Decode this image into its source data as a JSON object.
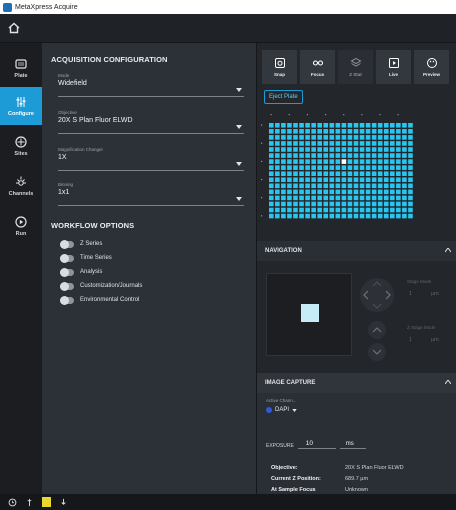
{
  "app": {
    "title": "MetaXpress Acquire"
  },
  "sidebar": {
    "items": [
      {
        "label": "Plate",
        "icon": "plate-icon"
      },
      {
        "label": "Configure",
        "icon": "sliders-icon",
        "active": true
      },
      {
        "label": "Sites",
        "icon": "sites-icon"
      },
      {
        "label": "Channels",
        "icon": "sun-icon"
      },
      {
        "label": "Run",
        "icon": "play-icon"
      }
    ]
  },
  "acquisition": {
    "title": "ACQUISITION CONFIGURATION",
    "fields": [
      {
        "label": "Mode",
        "value": "Widefield"
      },
      {
        "label": "Objective",
        "value": "20X S Plan Fluor ELWD"
      },
      {
        "label": "Magnification Changer",
        "value": "1X"
      },
      {
        "label": "Binning",
        "value": "1x1"
      }
    ]
  },
  "workflow": {
    "title": "WORKFLOW OPTIONS",
    "options": [
      "Z Series",
      "Time Series",
      "Analysis",
      "Customization/Journals",
      "Environmental Control"
    ]
  },
  "toolbar": {
    "buttons": [
      {
        "label": "Snap",
        "icon": "camera-icon"
      },
      {
        "label": "Focus",
        "icon": "focus-icon"
      },
      {
        "label": "Z Stat",
        "icon": "layers-icon"
      },
      {
        "label": "Live",
        "icon": "live-icon"
      },
      {
        "label": "Preview",
        "icon": "palette-icon"
      }
    ],
    "eject_label": "Eject Plate"
  },
  "plate": {
    "rows": 16,
    "cols": 24,
    "well_color": "#29c6f0",
    "selected_well_color": "#ffffff",
    "selected": {
      "row": 6,
      "col": 12
    }
  },
  "navigation": {
    "title": "NAVIGATION",
    "stage_label": "Stage Mode",
    "stage_value": "1",
    "stage_unit": "µm",
    "z_label": "Z Stage Mode",
    "z_value": "1",
    "z_unit": "µm"
  },
  "capture": {
    "title": "IMAGE CAPTURE",
    "active_channel_label": "Active Chann...",
    "active_channel": "DAPI",
    "exposure_label": "EXPOSURE",
    "exposure_value": "10",
    "exposure_unit": "ms",
    "info": [
      {
        "key": "Objective:",
        "value": "20X S Plan Fluor ELWD"
      },
      {
        "key": "Current Z Position:",
        "value": "689.7 µm"
      },
      {
        "key": "At Sample Focus",
        "value": "Unknown"
      }
    ]
  },
  "colors": {
    "accent": "#1d9bd6",
    "well": "#29c6f0",
    "channel_dot": "#2f5bd8"
  }
}
